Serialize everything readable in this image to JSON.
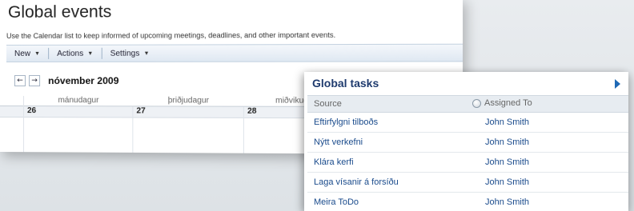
{
  "events": {
    "title": "Global events",
    "description": "Use the Calendar list to keep informed of upcoming meetings, deadlines, and other important events.",
    "toolbar": {
      "new_label": "New",
      "actions_label": "Actions",
      "settings_label": "Settings"
    },
    "calendar": {
      "month_label": "nóvember 2009",
      "prev_glyph": "←",
      "next_glyph": "→",
      "day_headers": [
        "mánudagur",
        "þriðjudagur",
        "miðvikudagur"
      ],
      "dates": [
        "26",
        "27",
        "28"
      ]
    }
  },
  "tasks": {
    "title": "Global tasks",
    "columns": {
      "source": "Source",
      "assigned_to": "Assigned To"
    },
    "rows": [
      {
        "source": "Eftirfylgni tilboðs",
        "assigned_to": "John Smith"
      },
      {
        "source": "Nýtt verkefni",
        "assigned_to": "John Smith"
      },
      {
        "source": "Klára kerfi",
        "assigned_to": "John Smith"
      },
      {
        "source": "Laga vísanir á forsíðu",
        "assigned_to": "John Smith"
      },
      {
        "source": "Meira ToDo",
        "assigned_to": "John Smith"
      }
    ]
  },
  "colors": {
    "tasks_title": "#1f3b6e",
    "link": "#1a4b8c",
    "expand_arrow": "#1f69b5"
  },
  "icons": [
    "chevron-down-icon",
    "left-arrow-icon",
    "right-arrow-icon",
    "expand-arrow-icon",
    "radio-icon"
  ]
}
